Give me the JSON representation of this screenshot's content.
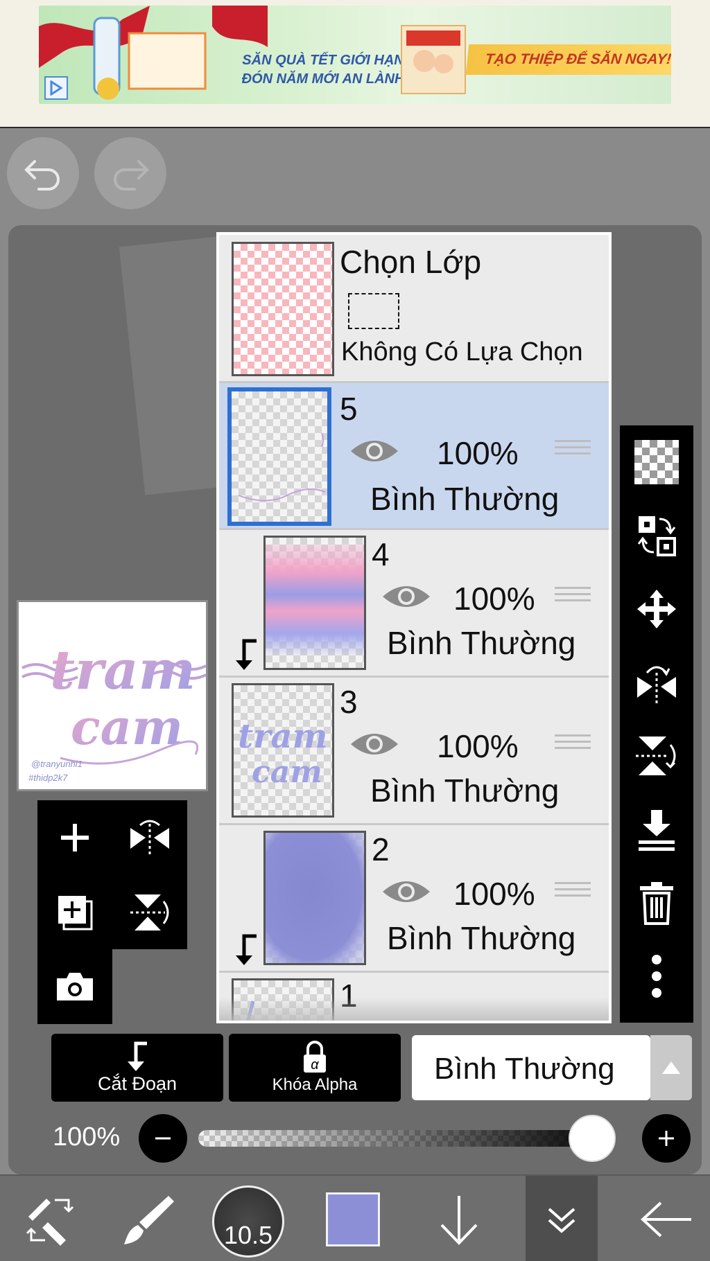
{
  "ad": {
    "line1": "SĂN QUÀ TẾT GIỚI HẠN",
    "line2": "ĐÓN NĂM MỚI AN LÀNH",
    "cta": "TẠO THIỆP ĐỂ SĂN NGAY!"
  },
  "layers_panel": {
    "selection_title": "Chọn Lớp",
    "selection_status": "Không Có Lựa Chọn",
    "layers": [
      {
        "number": "5",
        "opacity": "100%",
        "mode": "Bình Thường"
      },
      {
        "number": "4",
        "opacity": "100%",
        "mode": "Bình Thường"
      },
      {
        "number": "3",
        "opacity": "100%",
        "mode": "Bình Thường"
      },
      {
        "number": "2",
        "opacity": "100%",
        "mode": "Bình Thường"
      },
      {
        "number": "1"
      }
    ]
  },
  "bottom_controls": {
    "clipping_label": "Cắt Đoạn",
    "alpha_lock_label": "Khóa Alpha",
    "blend_mode": "Bình Thường",
    "opacity_label": "100%",
    "opacity_value": 1.0
  },
  "bottom_nav": {
    "brush_size": "10.5",
    "color": "#8c8fd6"
  },
  "thumbnail": {
    "signature1": "@tranyunhi1",
    "signature2": "#thidp2k7"
  },
  "icons": [
    "undo-icon",
    "redo-icon",
    "add-layer-icon",
    "flip-horizontal-icon",
    "duplicate-layer-icon",
    "flip-vertical-icon",
    "camera-icon",
    "checkerboard-icon",
    "transform-icon",
    "move-icon",
    "merge-down-icon",
    "delete-icon",
    "more-icon",
    "eye-icon",
    "grip-icon",
    "clip-arrow-icon",
    "lock-alpha-icon",
    "minus-icon",
    "plus-icon",
    "brush-eraser-swap-icon",
    "brush-icon",
    "arrow-down-icon",
    "double-chevron-down-icon",
    "back-arrow-icon"
  ]
}
